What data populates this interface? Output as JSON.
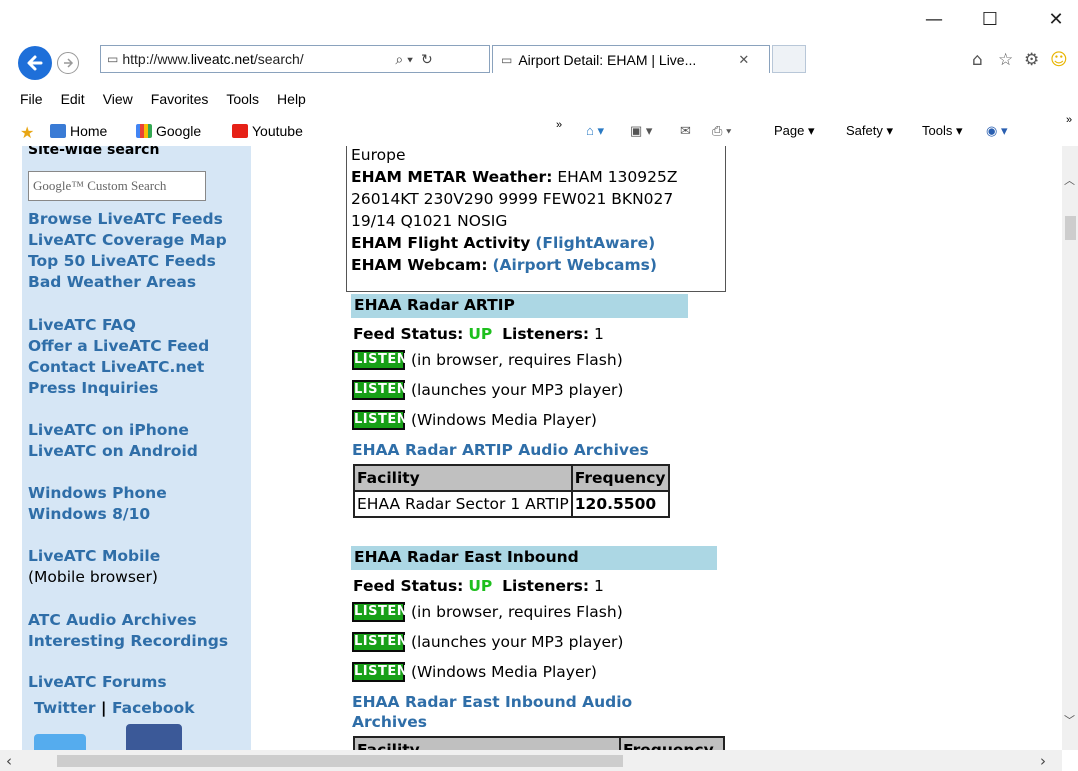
{
  "window": {
    "minimize": "—",
    "maximize": "☐",
    "close": "✕"
  },
  "nav": {
    "url_prefix": "http://www.",
    "url_domain": "liveatc.net",
    "url_suffix": "/search/",
    "search_dropdown": "⌕ ▾",
    "refresh": "↻",
    "tab_title": "Airport Detail: EHAM | Live...",
    "tab_close": "✕"
  },
  "menu": {
    "file": "File",
    "edit": "Edit",
    "view": "View",
    "favorites": "Favorites",
    "tools": "Tools",
    "help": "Help"
  },
  "favorites": {
    "home": "Home",
    "google": "Google",
    "youtube": "Youtube",
    "page_menu": "Page ▾",
    "safety_menu": "Safety ▾",
    "tools_menu": "Tools ▾"
  },
  "sidebar": {
    "search_title": "Site-wide search",
    "search_placeholder": "Google™ Custom Search",
    "links_group1": [
      "Browse LiveATC Feeds",
      "LiveATC Coverage Map",
      "Top 50 LiveATC Feeds",
      "Bad Weather Areas"
    ],
    "links_group2": [
      "LiveATC FAQ",
      "Offer a LiveATC Feed",
      "Contact LiveATC.net",
      "Press Inquiries"
    ],
    "links_group3": [
      "LiveATC on iPhone",
      "LiveATC on Android"
    ],
    "links_group4": [
      "Windows Phone",
      "Windows 8/10"
    ],
    "mobile_link": "LiveATC Mobile",
    "mobile_note": "(Mobile browser)",
    "links_group5": [
      "ATC Audio Archives",
      "Interesting Recordings"
    ],
    "forums": "LiveATC Forums",
    "twitter": "Twitter",
    "separator": "|",
    "facebook": "Facebook"
  },
  "info": {
    "region": "Europe",
    "metar_label": "EHAM METAR Weather:",
    "metar_line1": "EHAM 130925Z",
    "metar_line2": "26014KT 230V290 9999 FEW021 BKN027",
    "metar_line3": "19/14 Q1021 NOSIG",
    "flight_label": "EHAM Flight Activity",
    "flight_link": "(FlightAware)",
    "webcam_label": "EHAM Webcam:",
    "webcam_link": "(Airport Webcams)"
  },
  "feeds": [
    {
      "name": "EHAA Radar ARTIP",
      "status_label": "Feed Status:",
      "status": "UP",
      "listeners_label": "Listeners:",
      "listeners": "1",
      "listen_label": "LISTEN",
      "options": [
        "(in browser, requires Flash)",
        "(launches your MP3 player)",
        "(Windows Media Player)"
      ],
      "archive": "EHAA Radar ARTIP Audio Archives",
      "table_headers": [
        "Facility",
        "Frequency"
      ],
      "rows": [
        [
          "EHAA Radar Sector 1 ARTIP",
          "120.5500"
        ]
      ]
    },
    {
      "name": "EHAA Radar East Inbound",
      "status_label": "Feed Status:",
      "status": "UP",
      "listeners_label": "Listeners:",
      "listeners": "1",
      "listen_label": "LISTEN",
      "options": [
        "(in browser, requires Flash)",
        "(launches your MP3 player)",
        "(Windows Media Player)"
      ],
      "archive_line1": "EHAA Radar East Inbound Audio",
      "archive_line2": "Archives",
      "table_headers": [
        "Facility",
        "Frequency"
      ]
    }
  ],
  "colors": {
    "sidebar_bg": "#d6e6f5",
    "link_blue": "#2f6ea8",
    "section_bg": "#acd7e4",
    "status_up": "#1dbf1d",
    "listen_green": "#17a017"
  }
}
